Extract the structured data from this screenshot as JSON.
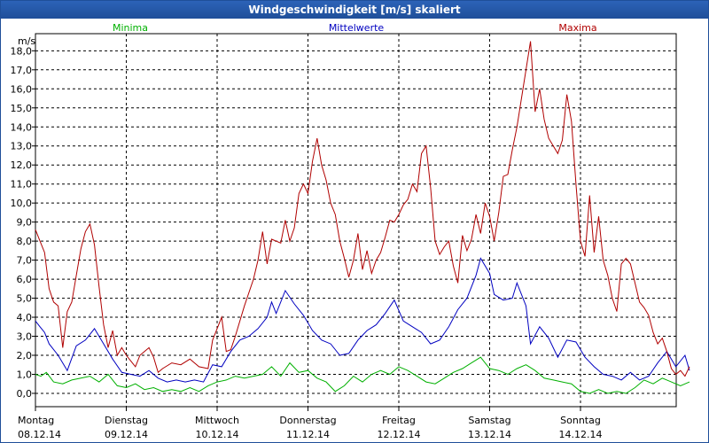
{
  "window": {
    "title": "Windgeschwindigkeit [m/s] skaliert"
  },
  "chart_data": {
    "type": "line",
    "title": "Windgeschwindigkeit [m/s] skaliert",
    "ylabel": "m/s",
    "ylim": [
      -0.7,
      18.9
    ],
    "yticks": [
      "0,0",
      "1,0",
      "2,0",
      "3,0",
      "4,0",
      "5,0",
      "6,0",
      "7,0",
      "8,0",
      "9,0",
      "10,0",
      "11,0",
      "12,0",
      "13,0",
      "14,0",
      "15,0",
      "16,0",
      "17,0",
      "18,0"
    ],
    "grid": true,
    "x_categories": [
      {
        "day": "Montag",
        "date": "08.12.14"
      },
      {
        "day": "Dienstag",
        "date": "09.12.14"
      },
      {
        "day": "Mittwoch",
        "date": "10.12.14"
      },
      {
        "day": "Donnerstag",
        "date": "11.12.14"
      },
      {
        "day": "Freitag",
        "date": "12.12.14"
      },
      {
        "day": "Samstag",
        "date": "13.12.14"
      },
      {
        "day": "Sonntag",
        "date": "14.12.14"
      }
    ],
    "legend_position": "top",
    "series": [
      {
        "name": "Minima",
        "color": "#00b000",
        "points": [
          [
            0,
            1.0
          ],
          [
            0.06,
            0.9
          ],
          [
            0.12,
            1.1
          ],
          [
            0.2,
            0.6
          ],
          [
            0.3,
            0.5
          ],
          [
            0.4,
            0.7
          ],
          [
            0.5,
            0.8
          ],
          [
            0.6,
            0.9
          ],
          [
            0.7,
            0.6
          ],
          [
            0.8,
            1.0
          ],
          [
            0.9,
            0.4
          ],
          [
            1.0,
            0.3
          ],
          [
            1.1,
            0.5
          ],
          [
            1.2,
            0.2
          ],
          [
            1.3,
            0.3
          ],
          [
            1.4,
            0.1
          ],
          [
            1.5,
            0.2
          ],
          [
            1.6,
            0.1
          ],
          [
            1.7,
            0.3
          ],
          [
            1.8,
            0.1
          ],
          [
            1.9,
            0.4
          ],
          [
            2.0,
            0.6
          ],
          [
            2.1,
            0.7
          ],
          [
            2.2,
            0.9
          ],
          [
            2.3,
            0.8
          ],
          [
            2.4,
            0.9
          ],
          [
            2.5,
            1.0
          ],
          [
            2.6,
            1.4
          ],
          [
            2.7,
            0.9
          ],
          [
            2.8,
            1.6
          ],
          [
            2.9,
            1.1
          ],
          [
            3.0,
            1.2
          ],
          [
            3.1,
            0.8
          ],
          [
            3.2,
            0.6
          ],
          [
            3.3,
            0.1
          ],
          [
            3.4,
            0.4
          ],
          [
            3.5,
            0.9
          ],
          [
            3.6,
            0.6
          ],
          [
            3.7,
            1.0
          ],
          [
            3.8,
            1.2
          ],
          [
            3.9,
            1.0
          ],
          [
            4.0,
            1.4
          ],
          [
            4.1,
            1.2
          ],
          [
            4.2,
            0.9
          ],
          [
            4.3,
            0.6
          ],
          [
            4.4,
            0.5
          ],
          [
            4.5,
            0.8
          ],
          [
            4.6,
            1.1
          ],
          [
            4.7,
            1.3
          ],
          [
            4.8,
            1.6
          ],
          [
            4.9,
            1.9
          ],
          [
            5.0,
            1.3
          ],
          [
            5.1,
            1.2
          ],
          [
            5.2,
            1.0
          ],
          [
            5.3,
            1.3
          ],
          [
            5.4,
            1.5
          ],
          [
            5.5,
            1.2
          ],
          [
            5.6,
            0.8
          ],
          [
            5.7,
            0.7
          ],
          [
            5.8,
            0.6
          ],
          [
            5.9,
            0.5
          ],
          [
            6.0,
            0.1
          ],
          [
            6.1,
            0.0
          ],
          [
            6.2,
            0.2
          ],
          [
            6.3,
            0.0
          ],
          [
            6.4,
            0.1
          ],
          [
            6.5,
            0.0
          ],
          [
            6.6,
            0.3
          ],
          [
            6.7,
            0.7
          ],
          [
            6.8,
            0.5
          ],
          [
            6.9,
            0.8
          ],
          [
            7.0,
            0.6
          ],
          [
            7.1,
            0.4
          ],
          [
            7.2,
            0.6
          ]
        ]
      },
      {
        "name": "Mittelwerte",
        "color": "#0000c0",
        "points": [
          [
            0,
            3.8
          ],
          [
            0.05,
            3.5
          ],
          [
            0.1,
            3.2
          ],
          [
            0.15,
            2.6
          ],
          [
            0.25,
            2.0
          ],
          [
            0.35,
            1.2
          ],
          [
            0.45,
            2.5
          ],
          [
            0.55,
            2.8
          ],
          [
            0.65,
            3.4
          ],
          [
            0.75,
            2.6
          ],
          [
            0.85,
            1.8
          ],
          [
            0.95,
            1.1
          ],
          [
            1.05,
            1.0
          ],
          [
            1.15,
            0.9
          ],
          [
            1.25,
            1.2
          ],
          [
            1.35,
            0.8
          ],
          [
            1.45,
            0.6
          ],
          [
            1.55,
            0.7
          ],
          [
            1.65,
            0.6
          ],
          [
            1.75,
            0.7
          ],
          [
            1.85,
            0.6
          ],
          [
            1.95,
            1.5
          ],
          [
            2.05,
            1.4
          ],
          [
            2.15,
            2.2
          ],
          [
            2.25,
            2.8
          ],
          [
            2.35,
            3.0
          ],
          [
            2.45,
            3.4
          ],
          [
            2.55,
            4.0
          ],
          [
            2.6,
            4.8
          ],
          [
            2.65,
            4.2
          ],
          [
            2.75,
            5.4
          ],
          [
            2.85,
            4.7
          ],
          [
            2.95,
            4.1
          ],
          [
            3.05,
            3.3
          ],
          [
            3.15,
            2.8
          ],
          [
            3.25,
            2.6
          ],
          [
            3.35,
            2.0
          ],
          [
            3.45,
            2.1
          ],
          [
            3.55,
            2.8
          ],
          [
            3.65,
            3.3
          ],
          [
            3.75,
            3.6
          ],
          [
            3.85,
            4.2
          ],
          [
            3.95,
            4.9
          ],
          [
            4.05,
            3.8
          ],
          [
            4.15,
            3.5
          ],
          [
            4.25,
            3.2
          ],
          [
            4.35,
            2.6
          ],
          [
            4.45,
            2.8
          ],
          [
            4.55,
            3.5
          ],
          [
            4.65,
            4.4
          ],
          [
            4.75,
            5.0
          ],
          [
            4.85,
            6.2
          ],
          [
            4.9,
            7.1
          ],
          [
            5.0,
            6.3
          ],
          [
            5.05,
            5.2
          ],
          [
            5.15,
            4.9
          ],
          [
            5.25,
            5.0
          ],
          [
            5.3,
            5.8
          ],
          [
            5.4,
            4.6
          ],
          [
            5.45,
            2.6
          ],
          [
            5.55,
            3.5
          ],
          [
            5.65,
            2.9
          ],
          [
            5.75,
            1.9
          ],
          [
            5.85,
            2.8
          ],
          [
            5.95,
            2.7
          ],
          [
            6.05,
            1.9
          ],
          [
            6.15,
            1.4
          ],
          [
            6.25,
            1.0
          ],
          [
            6.35,
            0.9
          ],
          [
            6.45,
            0.7
          ],
          [
            6.55,
            1.1
          ],
          [
            6.65,
            0.7
          ],
          [
            6.75,
            0.9
          ],
          [
            6.85,
            1.6
          ],
          [
            6.95,
            2.2
          ],
          [
            7.05,
            1.4
          ],
          [
            7.15,
            2.0
          ],
          [
            7.2,
            1.2
          ]
        ]
      },
      {
        "name": "Maxima",
        "color": "#b00000",
        "points": [
          [
            0,
            8.6
          ],
          [
            0.05,
            8.0
          ],
          [
            0.1,
            7.4
          ],
          [
            0.15,
            5.5
          ],
          [
            0.2,
            4.8
          ],
          [
            0.25,
            4.6
          ],
          [
            0.3,
            2.4
          ],
          [
            0.35,
            4.3
          ],
          [
            0.4,
            4.8
          ],
          [
            0.45,
            6.2
          ],
          [
            0.5,
            7.6
          ],
          [
            0.55,
            8.5
          ],
          [
            0.6,
            8.9
          ],
          [
            0.65,
            7.8
          ],
          [
            0.7,
            5.6
          ],
          [
            0.75,
            3.6
          ],
          [
            0.8,
            2.4
          ],
          [
            0.85,
            3.3
          ],
          [
            0.9,
            2.0
          ],
          [
            0.95,
            2.4
          ],
          [
            1.0,
            2.0
          ],
          [
            1.05,
            1.7
          ],
          [
            1.1,
            1.4
          ],
          [
            1.15,
            2.0
          ],
          [
            1.2,
            2.2
          ],
          [
            1.25,
            2.4
          ],
          [
            1.3,
            1.9
          ],
          [
            1.35,
            1.1
          ],
          [
            1.4,
            1.3
          ],
          [
            1.5,
            1.6
          ],
          [
            1.6,
            1.5
          ],
          [
            1.7,
            1.8
          ],
          [
            1.8,
            1.4
          ],
          [
            1.9,
            1.3
          ],
          [
            1.95,
            2.8
          ],
          [
            2.0,
            3.4
          ],
          [
            2.05,
            4.0
          ],
          [
            2.1,
            2.2
          ],
          [
            2.15,
            2.3
          ],
          [
            2.2,
            3.0
          ],
          [
            2.3,
            4.6
          ],
          [
            2.4,
            6.0
          ],
          [
            2.45,
            7.0
          ],
          [
            2.5,
            8.5
          ],
          [
            2.55,
            6.8
          ],
          [
            2.6,
            8.1
          ],
          [
            2.7,
            7.9
          ],
          [
            2.75,
            9.1
          ],
          [
            2.8,
            8.0
          ],
          [
            2.85,
            8.7
          ],
          [
            2.9,
            10.5
          ],
          [
            2.95,
            11.0
          ],
          [
            3.0,
            10.5
          ],
          [
            3.05,
            12.2
          ],
          [
            3.1,
            13.4
          ],
          [
            3.15,
            12.0
          ],
          [
            3.2,
            11.2
          ],
          [
            3.25,
            10.0
          ],
          [
            3.3,
            9.4
          ],
          [
            3.35,
            8.0
          ],
          [
            3.4,
            7.1
          ],
          [
            3.45,
            6.1
          ],
          [
            3.5,
            7.0
          ],
          [
            3.55,
            8.4
          ],
          [
            3.6,
            6.5
          ],
          [
            3.65,
            7.5
          ],
          [
            3.7,
            6.3
          ],
          [
            3.75,
            7.0
          ],
          [
            3.8,
            7.4
          ],
          [
            3.85,
            8.2
          ],
          [
            3.9,
            9.1
          ],
          [
            3.95,
            9.0
          ],
          [
            4.0,
            9.4
          ],
          [
            4.05,
            9.9
          ],
          [
            4.1,
            10.2
          ],
          [
            4.15,
            11.0
          ],
          [
            4.2,
            10.6
          ],
          [
            4.25,
            12.6
          ],
          [
            4.3,
            13.0
          ],
          [
            4.35,
            10.8
          ],
          [
            4.4,
            8.0
          ],
          [
            4.45,
            7.3
          ],
          [
            4.5,
            7.7
          ],
          [
            4.55,
            8.0
          ],
          [
            4.6,
            6.7
          ],
          [
            4.65,
            5.8
          ],
          [
            4.7,
            8.3
          ],
          [
            4.75,
            7.5
          ],
          [
            4.8,
            8.1
          ],
          [
            4.85,
            9.4
          ],
          [
            4.9,
            8.4
          ],
          [
            4.95,
            10.0
          ],
          [
            5.0,
            9.3
          ],
          [
            5.05,
            8.0
          ],
          [
            5.1,
            9.5
          ],
          [
            5.15,
            11.4
          ],
          [
            5.2,
            11.5
          ],
          [
            5.25,
            12.8
          ],
          [
            5.3,
            14.0
          ],
          [
            5.35,
            15.5
          ],
          [
            5.4,
            17.0
          ],
          [
            5.45,
            18.5
          ],
          [
            5.5,
            14.8
          ],
          [
            5.55,
            16.0
          ],
          [
            5.6,
            14.4
          ],
          [
            5.65,
            13.4
          ],
          [
            5.7,
            13.0
          ],
          [
            5.75,
            12.6
          ],
          [
            5.8,
            13.3
          ],
          [
            5.85,
            15.7
          ],
          [
            5.9,
            14.3
          ],
          [
            5.95,
            11.0
          ],
          [
            6.0,
            8.0
          ],
          [
            6.05,
            7.2
          ],
          [
            6.1,
            10.4
          ],
          [
            6.15,
            7.4
          ],
          [
            6.2,
            9.3
          ],
          [
            6.25,
            7.0
          ],
          [
            6.3,
            6.2
          ],
          [
            6.35,
            5.0
          ],
          [
            6.4,
            4.3
          ],
          [
            6.45,
            6.8
          ],
          [
            6.5,
            7.1
          ],
          [
            6.55,
            6.8
          ],
          [
            6.6,
            5.8
          ],
          [
            6.65,
            4.8
          ],
          [
            6.7,
            4.5
          ],
          [
            6.75,
            4.1
          ],
          [
            6.8,
            3.2
          ],
          [
            6.85,
            2.6
          ],
          [
            6.9,
            2.9
          ],
          [
            6.95,
            2.2
          ],
          [
            7.0,
            1.3
          ],
          [
            7.05,
            1.0
          ],
          [
            7.1,
            1.2
          ],
          [
            7.15,
            0.9
          ],
          [
            7.2,
            1.4
          ]
        ]
      }
    ]
  }
}
